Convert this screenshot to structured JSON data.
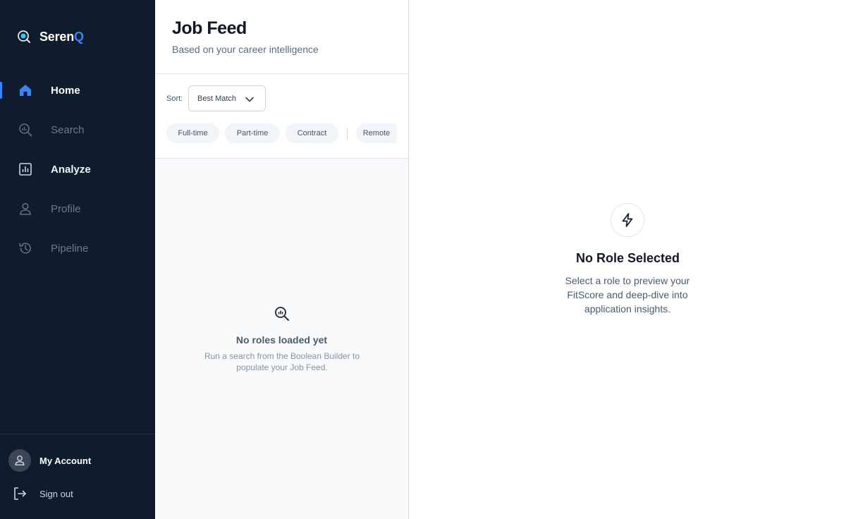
{
  "brand": {
    "name_main": "Seren",
    "name_accent": "Q",
    "accent_color": "#3b82f6",
    "logo_icon": "lens-logo-icon"
  },
  "sidebar": {
    "items": [
      {
        "label": "Home",
        "icon": "home-icon",
        "state": "active"
      },
      {
        "label": "Search",
        "icon": "search-analytics-icon",
        "state": "muted"
      },
      {
        "label": "Analyze",
        "icon": "bar-chart-icon",
        "state": "bold"
      },
      {
        "label": "Profile",
        "icon": "user-icon",
        "state": "muted"
      },
      {
        "label": "Pipeline",
        "icon": "history-icon",
        "state": "muted"
      }
    ],
    "account_label": "My Account",
    "signout_label": "Sign out"
  },
  "feed": {
    "title": "Job Feed",
    "subtitle": "Based on your career intelligence",
    "sort_label": "Sort:",
    "sort_value": "Best Match",
    "chips": [
      "Full-time",
      "Part-time",
      "Contract",
      "Remote"
    ],
    "empty_title": "No roles loaded yet",
    "empty_desc": "Run a search from the Boolean Builder to populate your Job Feed."
  },
  "detail": {
    "icon": "bolt-icon",
    "title": "No Role Selected",
    "desc": "Select a role to preview your FitScore and deep-dive into application insights."
  },
  "colors": {
    "sidebar_bg": "#111b2e",
    "accent": "#3b82f6",
    "feed_bg": "#f8fafc"
  }
}
